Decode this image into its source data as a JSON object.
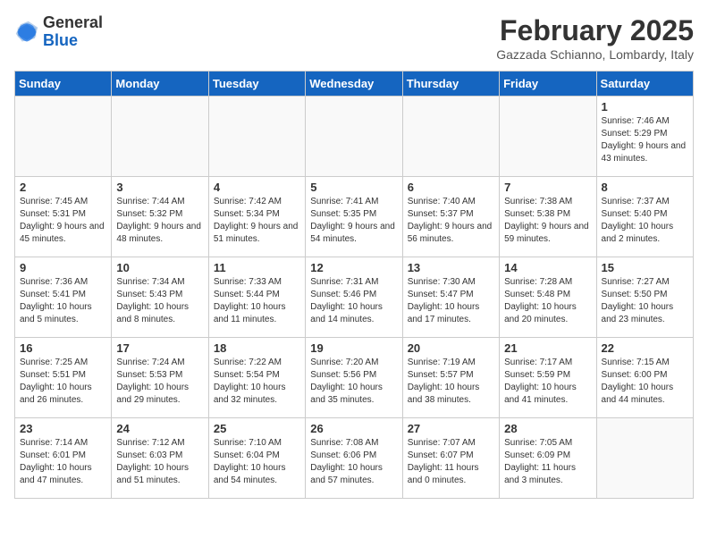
{
  "header": {
    "logo_general": "General",
    "logo_blue": "Blue",
    "title": "February 2025",
    "subtitle": "Gazzada Schianno, Lombardy, Italy"
  },
  "columns": [
    "Sunday",
    "Monday",
    "Tuesday",
    "Wednesday",
    "Thursday",
    "Friday",
    "Saturday"
  ],
  "weeks": [
    [
      {
        "day": "",
        "info": ""
      },
      {
        "day": "",
        "info": ""
      },
      {
        "day": "",
        "info": ""
      },
      {
        "day": "",
        "info": ""
      },
      {
        "day": "",
        "info": ""
      },
      {
        "day": "",
        "info": ""
      },
      {
        "day": "1",
        "info": "Sunrise: 7:46 AM\nSunset: 5:29 PM\nDaylight: 9 hours and 43 minutes."
      }
    ],
    [
      {
        "day": "2",
        "info": "Sunrise: 7:45 AM\nSunset: 5:31 PM\nDaylight: 9 hours and 45 minutes."
      },
      {
        "day": "3",
        "info": "Sunrise: 7:44 AM\nSunset: 5:32 PM\nDaylight: 9 hours and 48 minutes."
      },
      {
        "day": "4",
        "info": "Sunrise: 7:42 AM\nSunset: 5:34 PM\nDaylight: 9 hours and 51 minutes."
      },
      {
        "day": "5",
        "info": "Sunrise: 7:41 AM\nSunset: 5:35 PM\nDaylight: 9 hours and 54 minutes."
      },
      {
        "day": "6",
        "info": "Sunrise: 7:40 AM\nSunset: 5:37 PM\nDaylight: 9 hours and 56 minutes."
      },
      {
        "day": "7",
        "info": "Sunrise: 7:38 AM\nSunset: 5:38 PM\nDaylight: 9 hours and 59 minutes."
      },
      {
        "day": "8",
        "info": "Sunrise: 7:37 AM\nSunset: 5:40 PM\nDaylight: 10 hours and 2 minutes."
      }
    ],
    [
      {
        "day": "9",
        "info": "Sunrise: 7:36 AM\nSunset: 5:41 PM\nDaylight: 10 hours and 5 minutes."
      },
      {
        "day": "10",
        "info": "Sunrise: 7:34 AM\nSunset: 5:43 PM\nDaylight: 10 hours and 8 minutes."
      },
      {
        "day": "11",
        "info": "Sunrise: 7:33 AM\nSunset: 5:44 PM\nDaylight: 10 hours and 11 minutes."
      },
      {
        "day": "12",
        "info": "Sunrise: 7:31 AM\nSunset: 5:46 PM\nDaylight: 10 hours and 14 minutes."
      },
      {
        "day": "13",
        "info": "Sunrise: 7:30 AM\nSunset: 5:47 PM\nDaylight: 10 hours and 17 minutes."
      },
      {
        "day": "14",
        "info": "Sunrise: 7:28 AM\nSunset: 5:48 PM\nDaylight: 10 hours and 20 minutes."
      },
      {
        "day": "15",
        "info": "Sunrise: 7:27 AM\nSunset: 5:50 PM\nDaylight: 10 hours and 23 minutes."
      }
    ],
    [
      {
        "day": "16",
        "info": "Sunrise: 7:25 AM\nSunset: 5:51 PM\nDaylight: 10 hours and 26 minutes."
      },
      {
        "day": "17",
        "info": "Sunrise: 7:24 AM\nSunset: 5:53 PM\nDaylight: 10 hours and 29 minutes."
      },
      {
        "day": "18",
        "info": "Sunrise: 7:22 AM\nSunset: 5:54 PM\nDaylight: 10 hours and 32 minutes."
      },
      {
        "day": "19",
        "info": "Sunrise: 7:20 AM\nSunset: 5:56 PM\nDaylight: 10 hours and 35 minutes."
      },
      {
        "day": "20",
        "info": "Sunrise: 7:19 AM\nSunset: 5:57 PM\nDaylight: 10 hours and 38 minutes."
      },
      {
        "day": "21",
        "info": "Sunrise: 7:17 AM\nSunset: 5:59 PM\nDaylight: 10 hours and 41 minutes."
      },
      {
        "day": "22",
        "info": "Sunrise: 7:15 AM\nSunset: 6:00 PM\nDaylight: 10 hours and 44 minutes."
      }
    ],
    [
      {
        "day": "23",
        "info": "Sunrise: 7:14 AM\nSunset: 6:01 PM\nDaylight: 10 hours and 47 minutes."
      },
      {
        "day": "24",
        "info": "Sunrise: 7:12 AM\nSunset: 6:03 PM\nDaylight: 10 hours and 51 minutes."
      },
      {
        "day": "25",
        "info": "Sunrise: 7:10 AM\nSunset: 6:04 PM\nDaylight: 10 hours and 54 minutes."
      },
      {
        "day": "26",
        "info": "Sunrise: 7:08 AM\nSunset: 6:06 PM\nDaylight: 10 hours and 57 minutes."
      },
      {
        "day": "27",
        "info": "Sunrise: 7:07 AM\nSunset: 6:07 PM\nDaylight: 11 hours and 0 minutes."
      },
      {
        "day": "28",
        "info": "Sunrise: 7:05 AM\nSunset: 6:09 PM\nDaylight: 11 hours and 3 minutes."
      },
      {
        "day": "",
        "info": ""
      }
    ]
  ]
}
